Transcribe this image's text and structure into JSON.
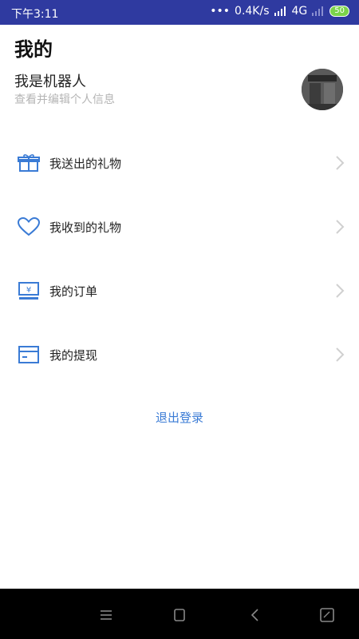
{
  "status_bar": {
    "time": "下午3:11",
    "network_speed": "0.4K/s",
    "network_type": "4G",
    "battery": "50"
  },
  "header": {
    "title": "我的"
  },
  "profile": {
    "name": "我是机器人",
    "hint": "查看并编辑个人信息"
  },
  "menu": {
    "items": [
      {
        "label": "我送出的礼物",
        "icon": "gift-icon"
      },
      {
        "label": "我收到的礼物",
        "icon": "heart-icon"
      },
      {
        "label": "我的订单",
        "icon": "order-icon"
      },
      {
        "label": "我的提现",
        "icon": "withdraw-icon"
      }
    ]
  },
  "logout": {
    "label": "退出登录"
  },
  "colors": {
    "status_bar": "#2f3aa0",
    "accent": "#3a7bd5",
    "icon": "#3a7bd5"
  }
}
